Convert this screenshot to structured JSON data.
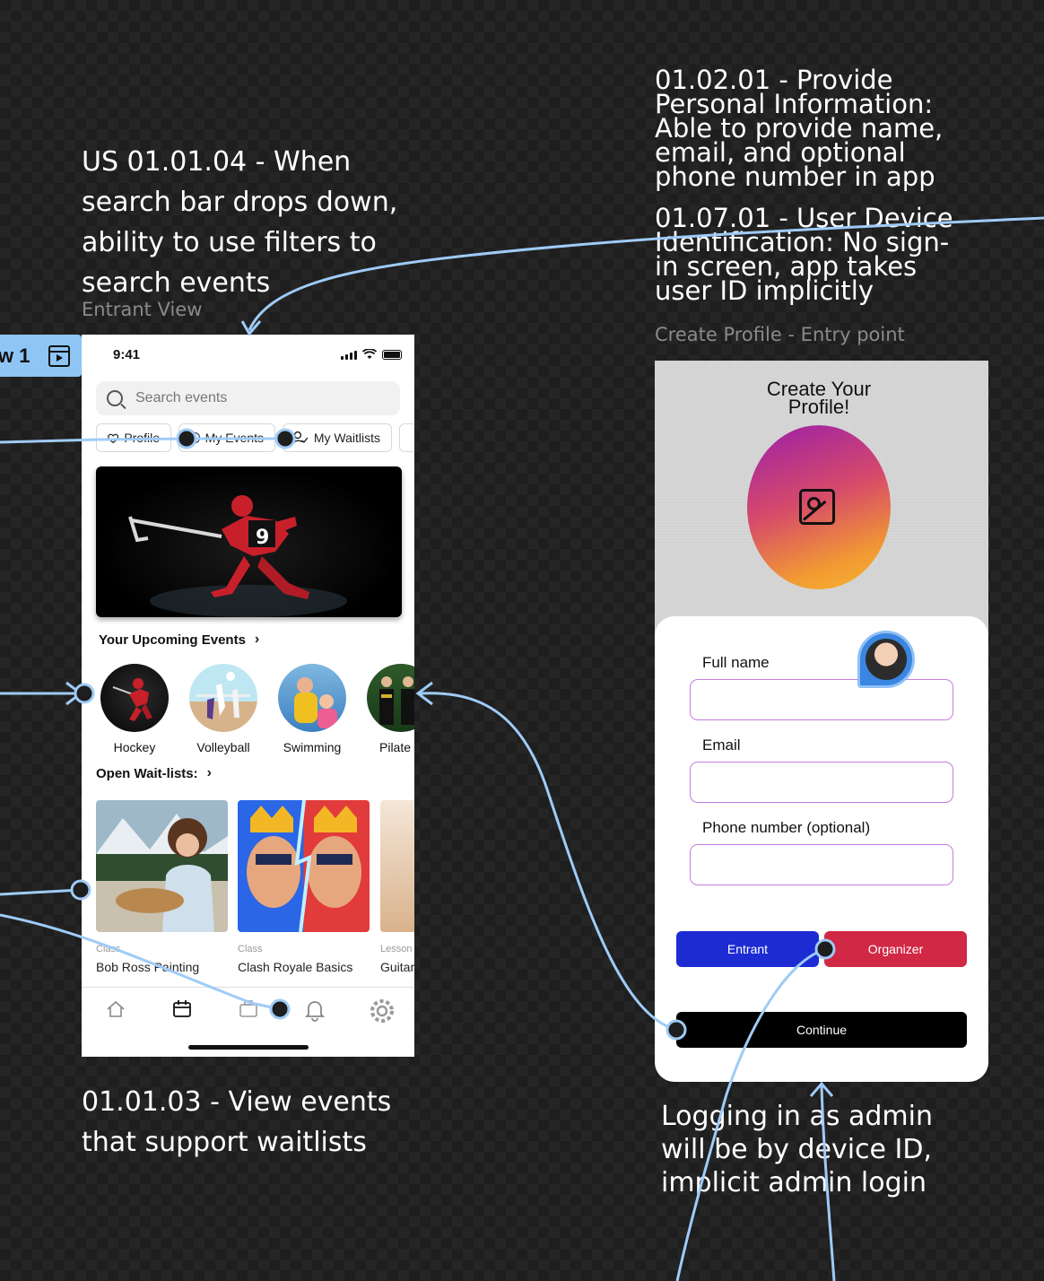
{
  "notes": {
    "search_filters": [
      "US 01.01.04 - When",
      "search bar drops down,",
      "ability to use filters to",
      "search events"
    ],
    "personal_info": [
      "01.02.01 - Provide",
      "Personal Information:",
      "Able to provide name,",
      "email, and optional",
      "phone number in app"
    ],
    "device_id": [
      "01.07.01 - User Device",
      "Identification: No sign-",
      "in screen, app takes",
      "user ID implicitly"
    ],
    "view_waitlists": [
      "01.01.03 - View events",
      "that support waitlists"
    ],
    "admin_login": [
      "Logging in as admin",
      "will be by device ID,",
      "implicit admin login"
    ]
  },
  "frame_labels": {
    "entrant": "Entrant View",
    "profile": "Create Profile - Entry point"
  },
  "prototype_chip": {
    "label": "w 1"
  },
  "entrant": {
    "status_time": "9:41",
    "search_placeholder": "Search events",
    "chips": [
      "Profile",
      "My Events",
      "My Waitlists"
    ],
    "upcoming_title": "Your Upcoming Events",
    "upcoming": [
      "Hockey",
      "Volleyball",
      "Swimming",
      "Pilate"
    ],
    "waitlist_title": "Open Wait-lists:",
    "waitlists": [
      {
        "kicker": "Class",
        "title": "Bob Ross Painting"
      },
      {
        "kicker": "Class",
        "title": "Clash Royale Basics"
      },
      {
        "kicker": "Lesson",
        "title": "Guitar"
      }
    ]
  },
  "profile": {
    "title_line1": "Create Your",
    "title_line2": "Profile!",
    "full_name_label": "Full name",
    "email_label": "Email",
    "phone_label": "Phone number (optional)",
    "entrant_btn": "Entrant",
    "organizer_btn": "Organizer",
    "continue_btn": "Continue"
  },
  "colors": {
    "wire": "#9fcbf7",
    "entrant_btn": "#1d2bd3",
    "organizer_btn": "#d02845",
    "continue_btn": "#000000",
    "field_border": "#c77de0"
  }
}
